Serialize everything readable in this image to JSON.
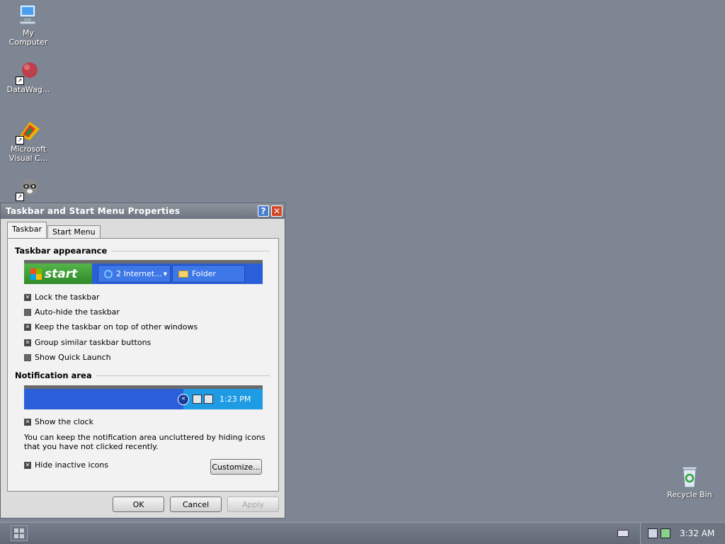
{
  "desktop": {
    "icons": [
      {
        "label_line1": "My",
        "label_line2": "Computer",
        "icon": "my-computer-icon"
      },
      {
        "label_line1": "DataWag...",
        "label_line2": "",
        "icon": "datawag-icon"
      },
      {
        "label_line1": "Microsoft",
        "label_line2": "Visual C...",
        "icon": "visual-c-icon"
      },
      {
        "label_line1": "",
        "label_line2": "",
        "icon": "raccoon-app-icon"
      },
      {
        "label_line1": "Recycle Bin",
        "label_line2": "",
        "icon": "recycle-bin-icon"
      }
    ]
  },
  "dialog": {
    "title": "Taskbar and Start Menu Properties",
    "tabs": [
      {
        "label": "Taskbar",
        "active": true
      },
      {
        "label": "Start Menu",
        "active": false
      }
    ],
    "appearance": {
      "heading": "Taskbar appearance",
      "preview": {
        "start_label": "start",
        "item1": "2 Internet...",
        "item2": "Folder"
      },
      "options": [
        {
          "label": "Lock the taskbar",
          "checked": true
        },
        {
          "label": "Auto-hide the taskbar",
          "checked": false
        },
        {
          "label": "Keep the taskbar on top of other windows",
          "checked": true
        },
        {
          "label": "Group similar taskbar buttons",
          "checked": true
        },
        {
          "label": "Show Quick Launch",
          "checked": false
        }
      ]
    },
    "notification": {
      "heading": "Notification area",
      "preview_time": "1:23 PM",
      "show_clock": {
        "label": "Show the clock",
        "checked": true
      },
      "note": "You can keep the notification area uncluttered by hiding icons that you have not clicked recently.",
      "hide_inactive": {
        "label": "Hide inactive icons",
        "checked": true
      },
      "customize_label": "Customize..."
    },
    "buttons": {
      "ok": "OK",
      "cancel": "Cancel",
      "apply": "Apply"
    }
  },
  "taskbar": {
    "clock": "3:32 AM"
  }
}
